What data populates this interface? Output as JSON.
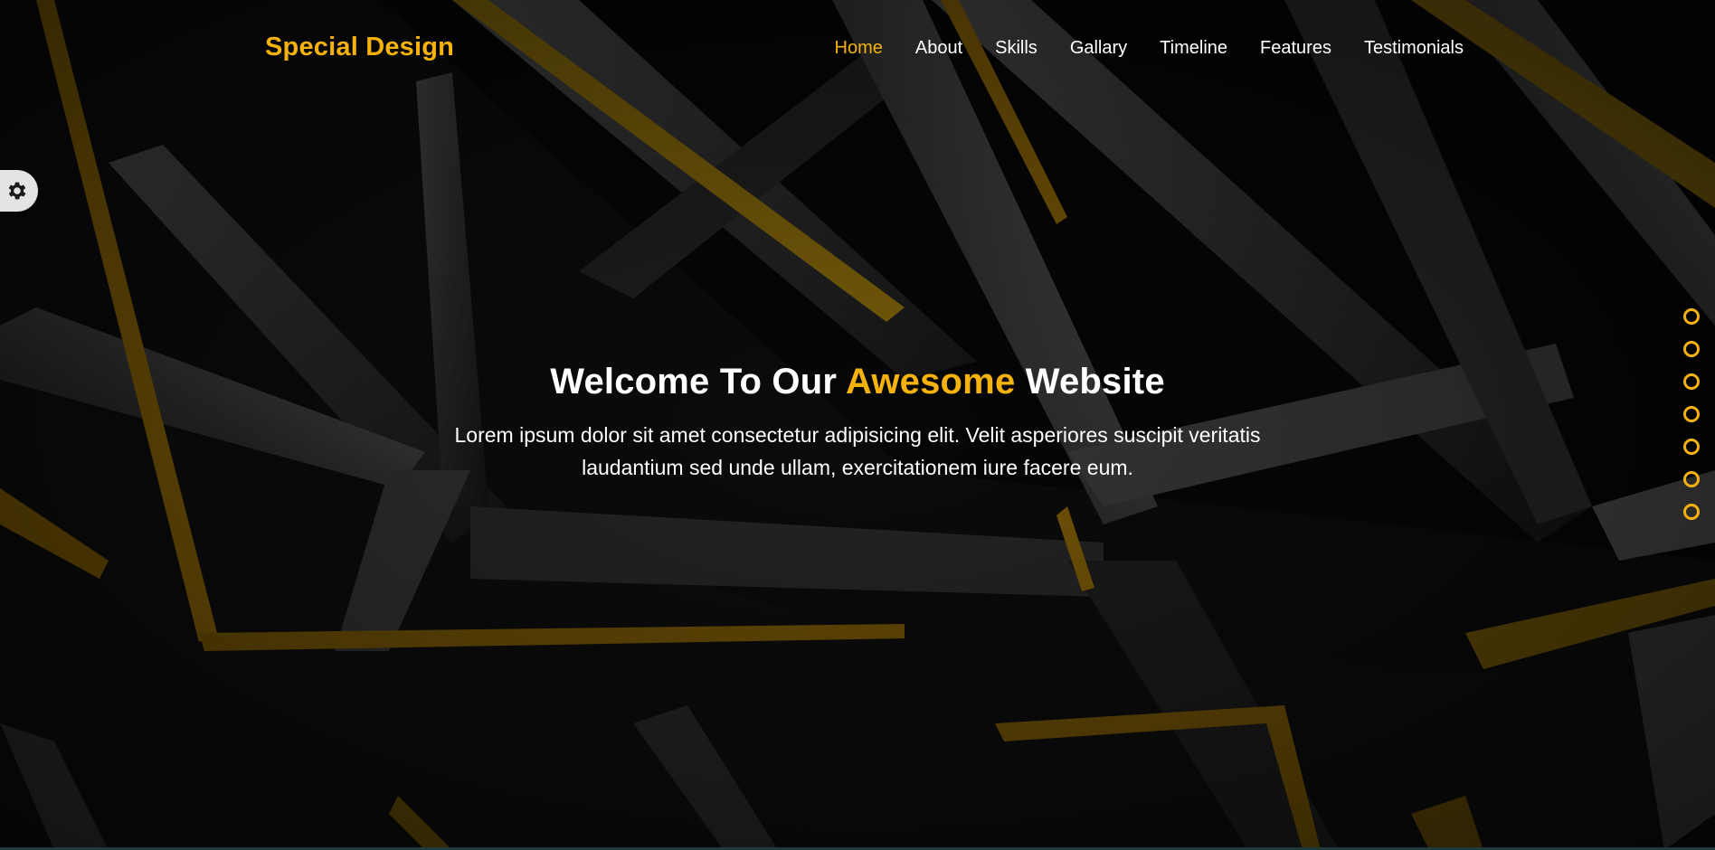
{
  "brand": {
    "logo_text": "Special Design",
    "accent_color": "#f5b20c"
  },
  "nav": {
    "items": [
      {
        "label": "Home",
        "active": true
      },
      {
        "label": "About",
        "active": false
      },
      {
        "label": "Skills",
        "active": false
      },
      {
        "label": "Gallary",
        "active": false
      },
      {
        "label": "Timeline",
        "active": false
      },
      {
        "label": "Features",
        "active": false
      },
      {
        "label": "Testimonials",
        "active": false
      }
    ]
  },
  "settings": {
    "icon": "gear-icon"
  },
  "bullets": {
    "count": 7,
    "icon": "circle-outline"
  },
  "intro": {
    "title_prefix": "Welcome To Our",
    "title_accent": "Awesome",
    "title_suffix": "Website",
    "paragraph": "Lorem ipsum dolor sit amet consectetur adipisicing elit. Velit asperiores suscipit veritatis laudantium sed unde ullam, exercitationem iure facere eum."
  }
}
